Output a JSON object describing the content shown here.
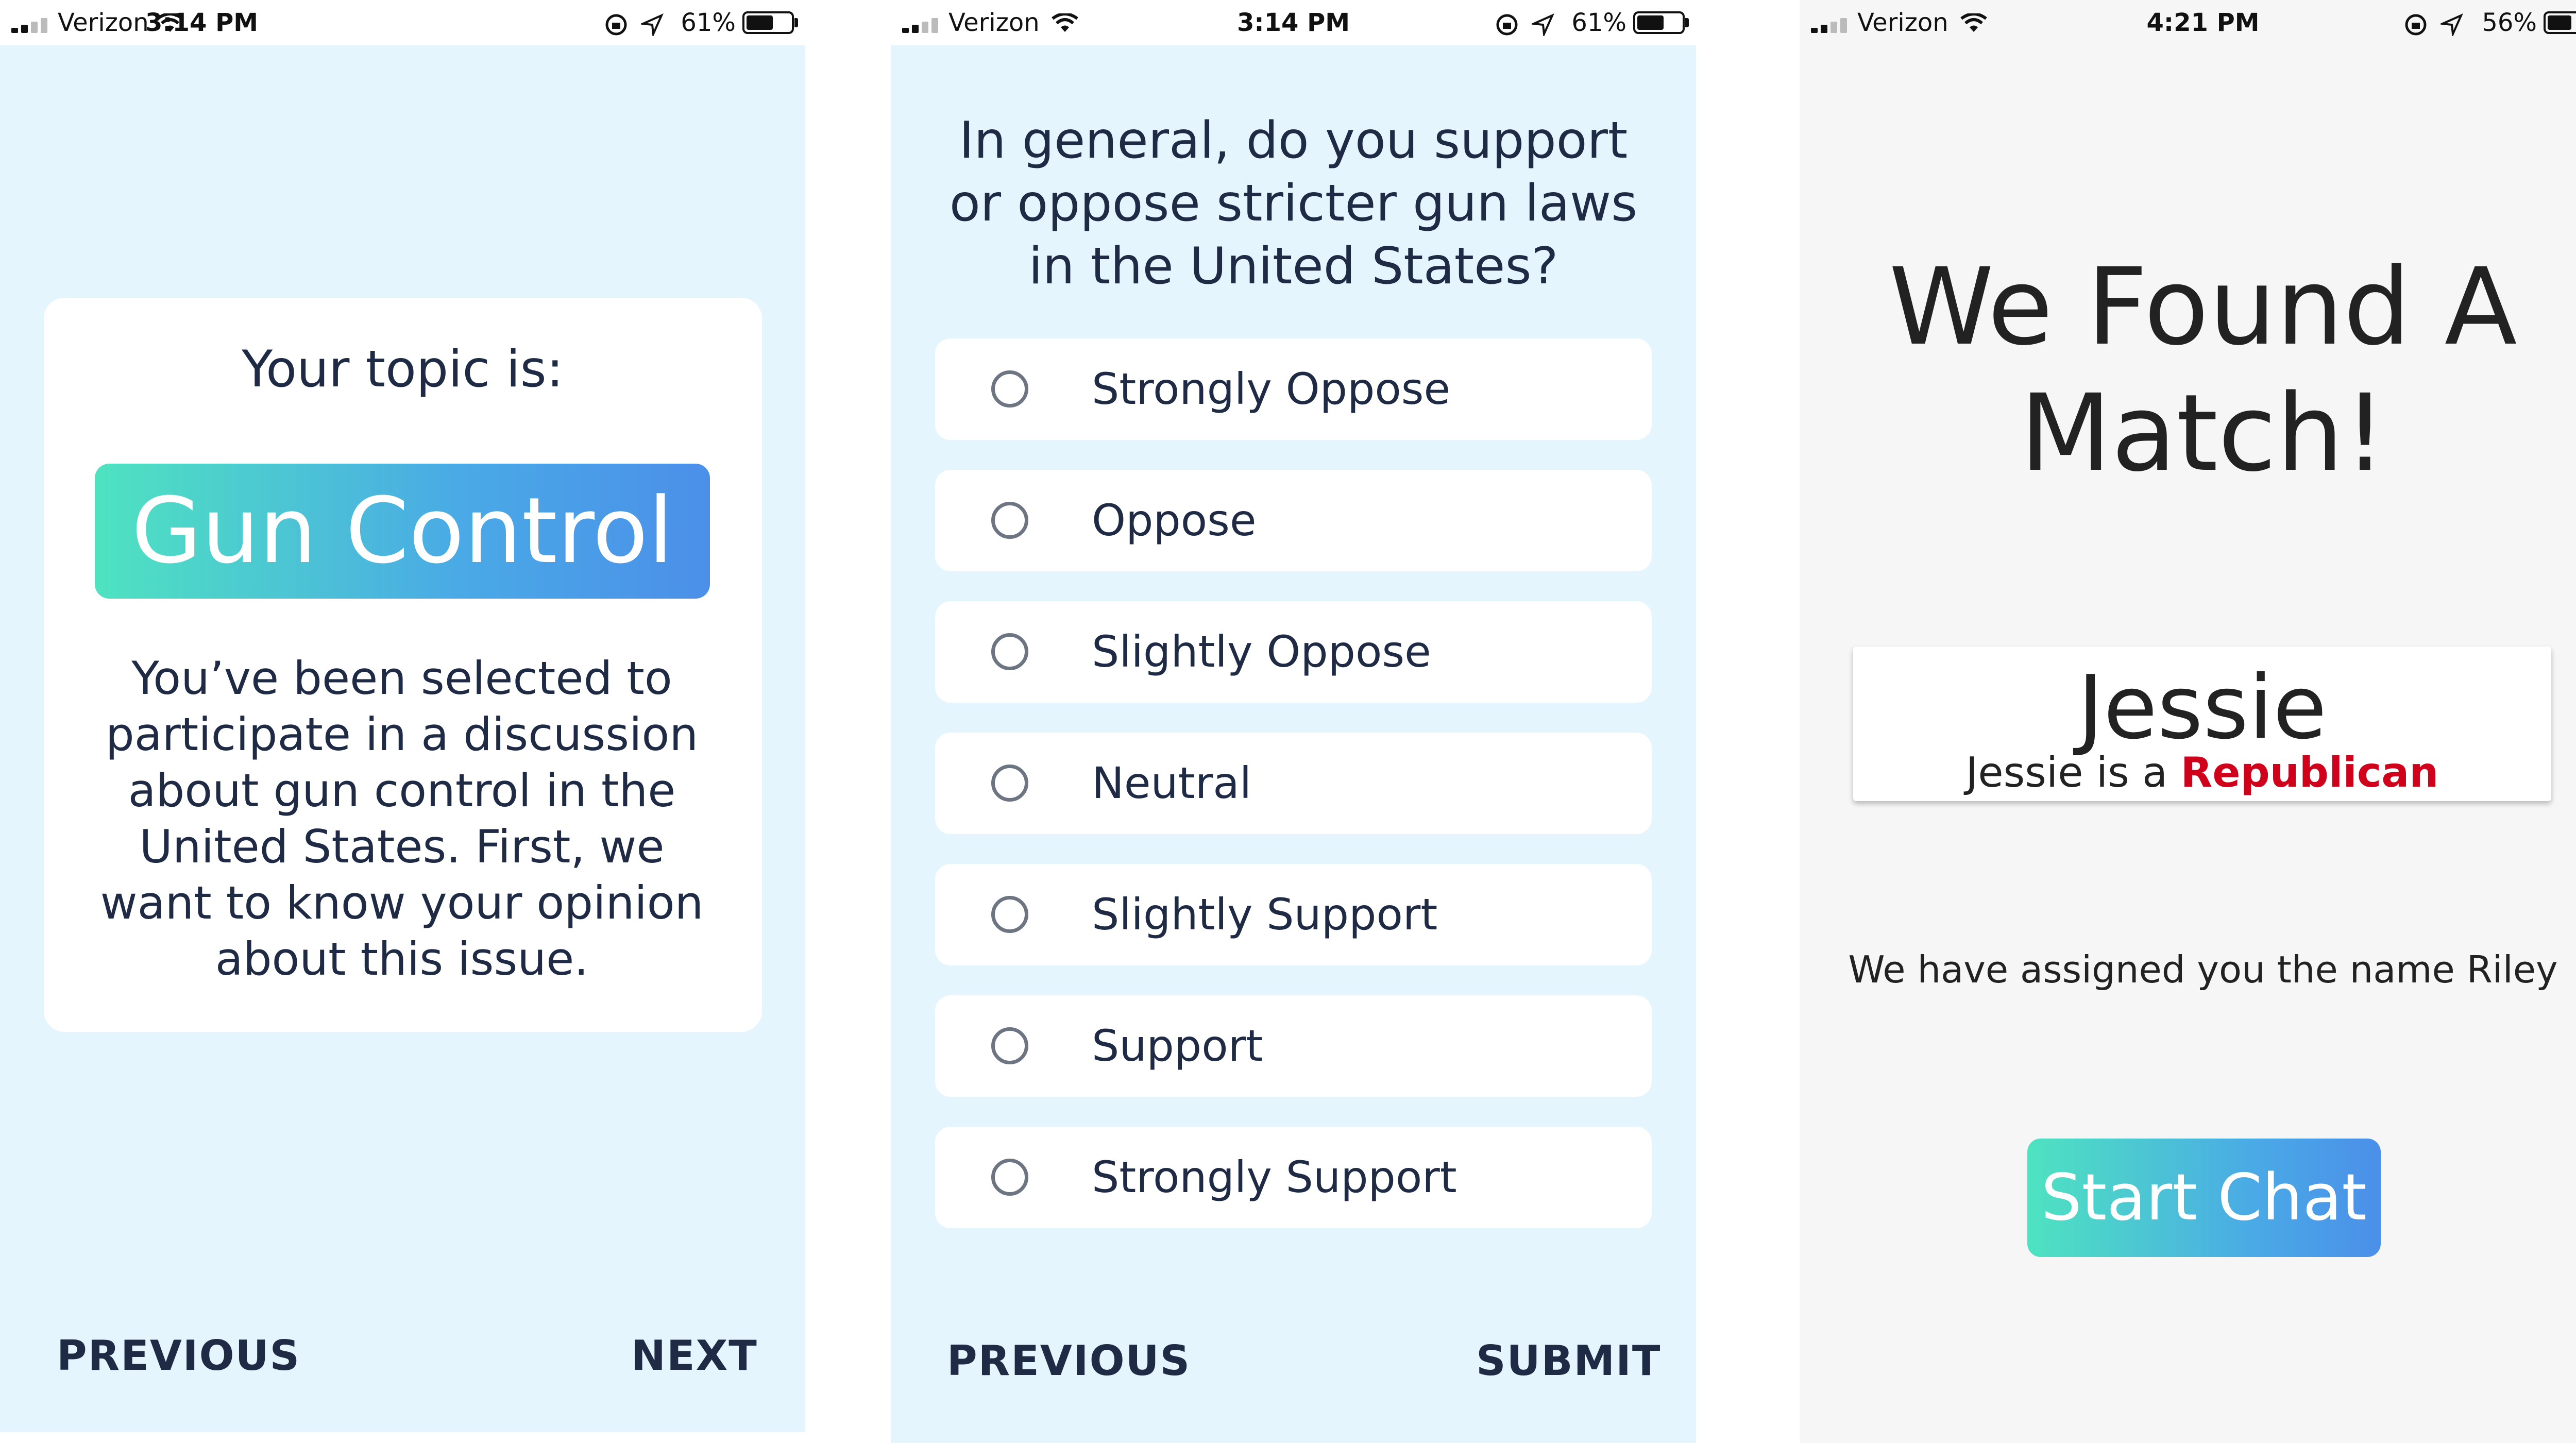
{
  "screen1": {
    "status": {
      "carrier": "Verizon",
      "time": "3:14 PM",
      "battery": "61%"
    },
    "topic_label": "Your topic is:",
    "topic": "Gun Control",
    "intro_lines": [
      "You’ve been selected to",
      "participate in a discussion",
      "about gun control in the",
      "United States. First, we",
      "want to know your opinion",
      "about this issue."
    ],
    "nav": {
      "previous": "PREVIOUS",
      "next": "NEXT"
    }
  },
  "screen2": {
    "status": {
      "carrier": "Verizon",
      "time": "3:14 PM",
      "battery": "61%"
    },
    "question_lines": [
      "In general, do you support",
      "or oppose stricter gun laws",
      "in the United States?"
    ],
    "options": [
      "Strongly Oppose",
      "Oppose",
      "Slightly Oppose",
      "Neutral",
      "Slightly Support",
      "Support",
      "Strongly Support"
    ],
    "nav": {
      "previous": "PREVIOUS",
      "submit": "SUBMIT"
    }
  },
  "screen3": {
    "status": {
      "carrier": "Verizon",
      "time": "4:21 PM",
      "battery": "56%"
    },
    "title_lines": [
      "We Found A",
      "Match!"
    ],
    "match_name": "Jessie",
    "match_party_prefix": "Jessie is a",
    "match_party": "Republican",
    "assigned": "We have assigned you the name Riley",
    "start_chat": "Start Chat"
  },
  "colors": {
    "app_background": "#e5f5fe",
    "text": "#1f2a44",
    "gradient_start": "#4ee3c0",
    "gradient_end": "#4b8fe9",
    "party_red": "#d0021b"
  },
  "battery_levels": {
    "screen1": 0.61,
    "screen2": 0.61,
    "screen3": 0.56
  }
}
